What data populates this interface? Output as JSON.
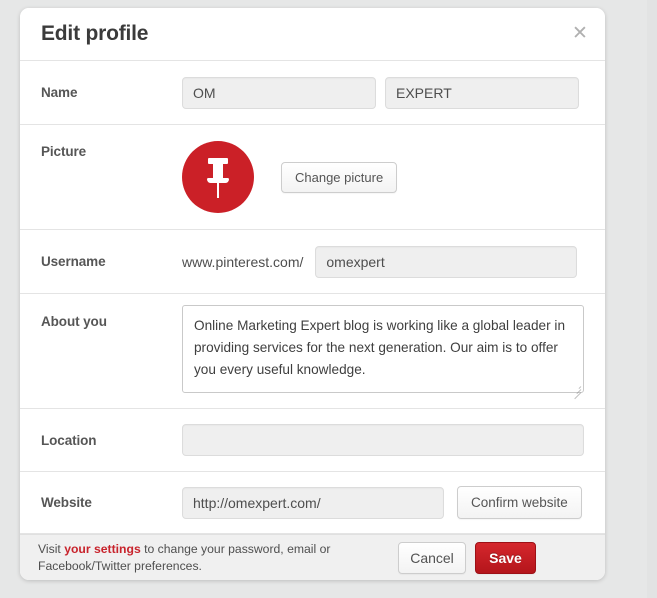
{
  "modal": {
    "title": "Edit profile",
    "close_icon": "close-icon"
  },
  "rows": {
    "name": {
      "label": "Name",
      "first_value": "OM",
      "last_value": "EXPERT",
      "first_placeholder": "",
      "last_placeholder": ""
    },
    "picture": {
      "label": "Picture",
      "avatar_icon": "pushpin-icon",
      "avatar_color": "#cb2027",
      "change_button": "Change picture"
    },
    "username": {
      "label": "Username",
      "prefix": "www.pinterest.com/",
      "value": "omexpert",
      "placeholder": ""
    },
    "about": {
      "label": "About you",
      "value": "Online Marketing Expert blog is working like a global leader in providing services for the next generation. Our aim is to offer you every useful knowledge.",
      "placeholder": ""
    },
    "location": {
      "label": "Location",
      "value": "",
      "placeholder": ""
    },
    "website": {
      "label": "Website",
      "value": "http://omexpert.com/",
      "placeholder": "",
      "confirm_button": "Confirm website"
    }
  },
  "footer": {
    "note_prefix": "Visit ",
    "note_link": "your settings",
    "note_suffix": " to change your password, email or Facebook/Twitter preferences.",
    "cancel_label": "Cancel",
    "save_label": "Save",
    "save_color": "#c8232c"
  }
}
